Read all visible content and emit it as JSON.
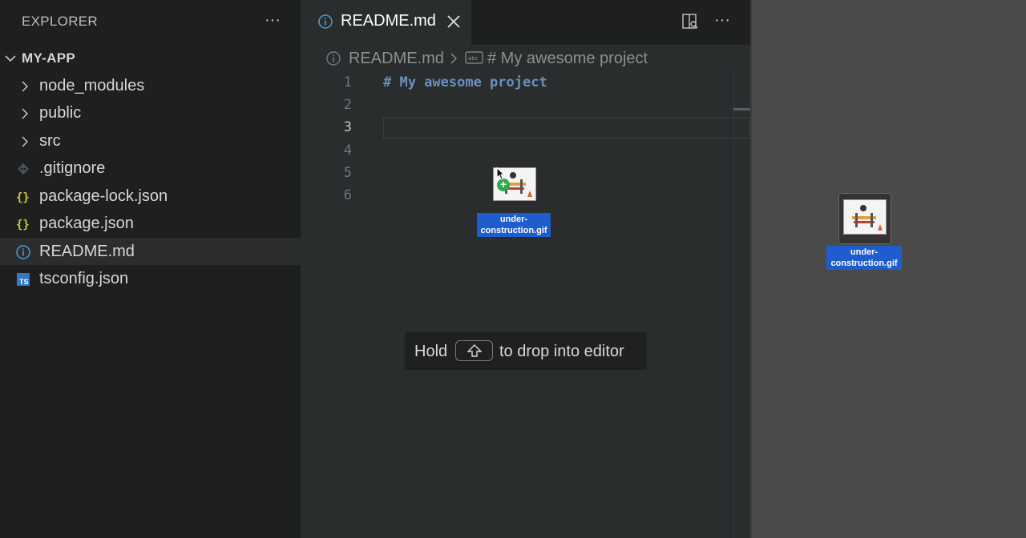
{
  "sidebar": {
    "title": "EXPLORER",
    "more_icon": "ellipsis-icon",
    "section_label": "MY-APP",
    "items": [
      {
        "label": "node_modules",
        "kind": "folder"
      },
      {
        "label": "public",
        "kind": "folder"
      },
      {
        "label": "src",
        "kind": "folder"
      },
      {
        "label": ".gitignore",
        "kind": "git-file"
      },
      {
        "label": "package-lock.json",
        "kind": "json-file"
      },
      {
        "label": "package.json",
        "kind": "json-file"
      },
      {
        "label": "README.md",
        "kind": "info-file",
        "selected": true
      },
      {
        "label": "tsconfig.json",
        "kind": "ts-file"
      }
    ]
  },
  "editor": {
    "tab": {
      "label": "README.md",
      "icon": "info-icon",
      "close_icon": "close-icon"
    },
    "actions": {
      "split_icon": "open-preview-to-side-icon",
      "more_icon": "ellipsis-icon"
    },
    "breadcrumb": {
      "file": "README.md",
      "symbol": "# My awesome project"
    },
    "line_numbers": [
      "1",
      "2",
      "3",
      "4",
      "5",
      "6"
    ],
    "active_line": "3",
    "lines": [
      "# My awesome project",
      "",
      "",
      "",
      "",
      ""
    ]
  },
  "drag": {
    "file_name_line1": "under-",
    "file_name_line2": "construction.gif"
  },
  "drop_hint": {
    "before": "Hold",
    "key_icon": "shift-key-icon",
    "after": "to drop into editor"
  },
  "colors": {
    "accent_info": "#4a9fd8",
    "json_icon": "#cbcb41",
    "ts_icon": "#3178c6",
    "selection_label": "#1f5ccd"
  }
}
